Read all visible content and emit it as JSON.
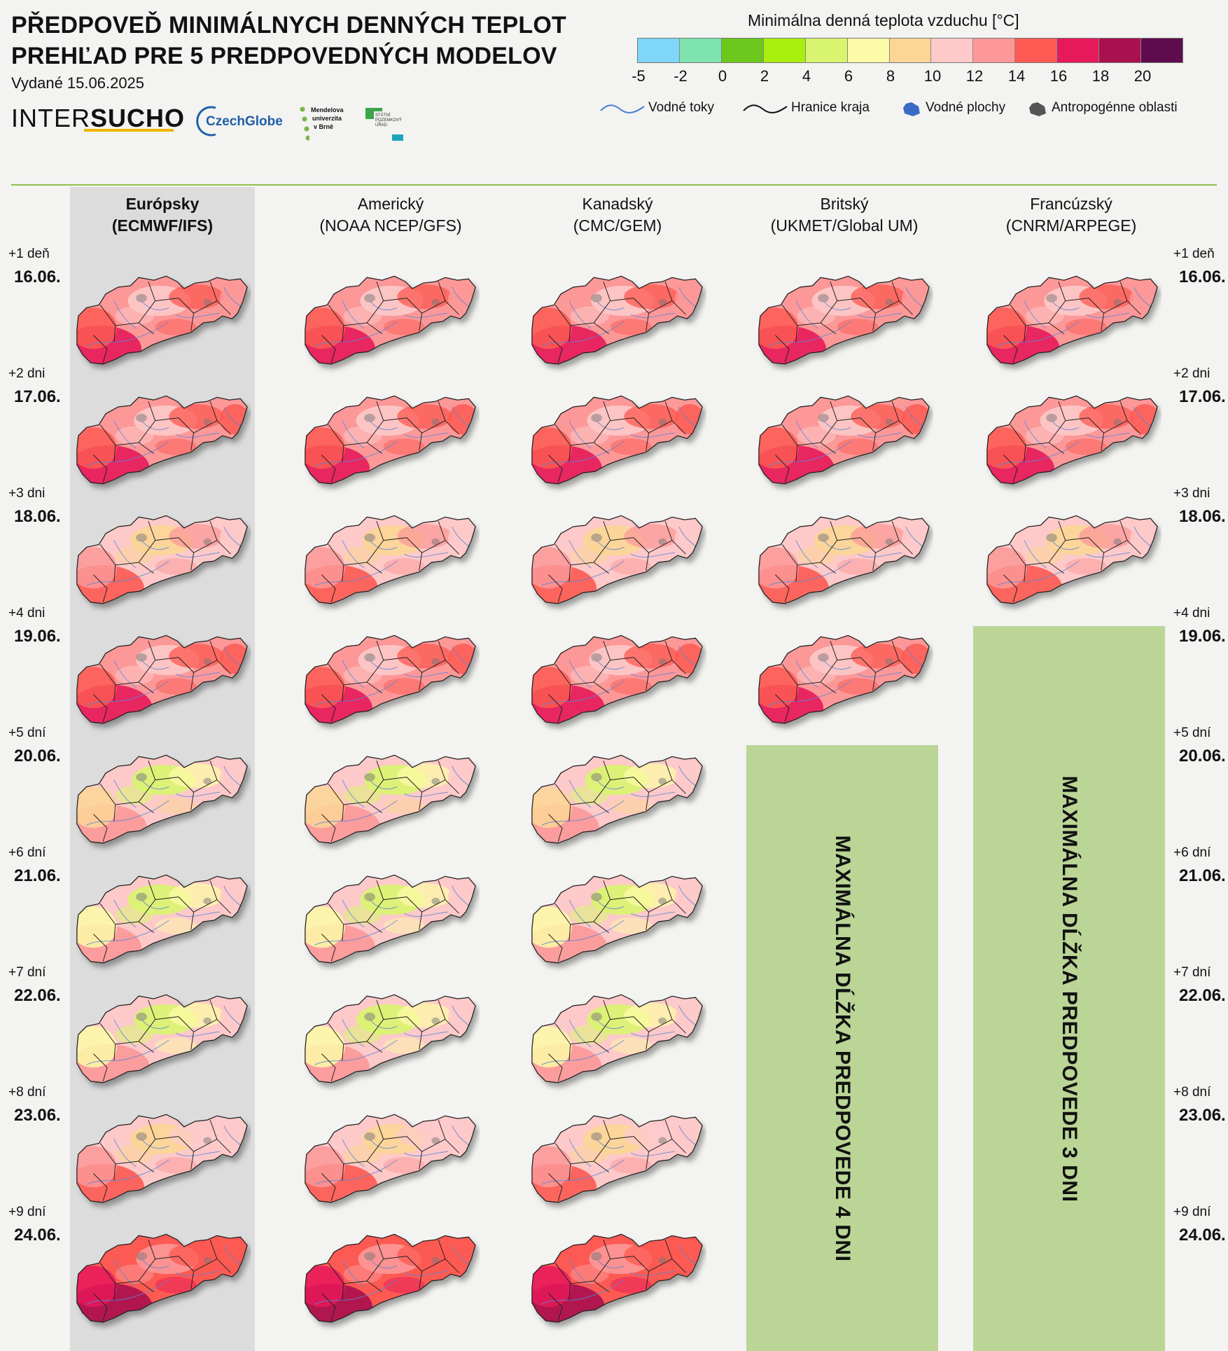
{
  "header": {
    "title_line1": "PŘEDPOVEĎ MINIMÁLNYCH DENNÝCH TEPLOT",
    "title_line2": "PREHĽAD PRE 5 PREDPOVEDNÝCH MODELOV",
    "issued": "Vydané 15.06.2025"
  },
  "logos": {
    "intersucho_a": "INTER",
    "intersucho_b": "SUCHO",
    "czechglobe": "CzechGlobe",
    "mendel": [
      "Mendelova",
      "univerzita",
      "v Brně"
    ],
    "spu": [
      "STÁTNÍ",
      "POZEMKOVÝ",
      "ÚŘAD"
    ]
  },
  "legend": {
    "title": "Minimálna denná teplota vzduchu [°C]",
    "colors": [
      "#7fd6f7",
      "#7ee3ad",
      "#6cc81d",
      "#a9ef0d",
      "#d9f56f",
      "#fcfaa7",
      "#fbd695",
      "#fdc9c9",
      "#fc9898",
      "#fc5a52",
      "#e6195a",
      "#a8104e",
      "#5e0c4d"
    ],
    "ticks": [
      "-5",
      "-2",
      "0",
      "2",
      "4",
      "6",
      "8",
      "10",
      "12",
      "14",
      "16",
      "18",
      "20"
    ],
    "symbols": [
      {
        "icon": "river-line-icon",
        "label": "Vodné toky"
      },
      {
        "icon": "border-line-icon",
        "label": "Hranice kraja"
      },
      {
        "icon": "water-area-icon",
        "label": "Vodné plochy"
      },
      {
        "icon": "urban-area-icon",
        "label": "Antropogénne oblasti"
      }
    ]
  },
  "models": [
    {
      "name": "Európsky",
      "sub": "(ECMWF/IFS)",
      "highlight": true,
      "days": 9
    },
    {
      "name": "Americký",
      "sub": "(NOAA NCEP/GFS)",
      "highlight": false,
      "days": 9
    },
    {
      "name": "Kanadský",
      "sub": "(CMC/GEM)",
      "highlight": false,
      "days": 9
    },
    {
      "name": "Britský",
      "sub": "(UKMET/Global UM)",
      "highlight": false,
      "days": 4
    },
    {
      "name": "Francúzský",
      "sub": "(CNRM/ARPEGE)",
      "highlight": false,
      "days": 3
    }
  ],
  "days": [
    {
      "lead": "+1 deň",
      "date": "16.06."
    },
    {
      "lead": "+2 dni",
      "date": "17.06."
    },
    {
      "lead": "+3 dni",
      "date": "18.06."
    },
    {
      "lead": "+4 dni",
      "date": "19.06."
    },
    {
      "lead": "+5 dní",
      "date": "20.06."
    },
    {
      "lead": "+6 dní",
      "date": "21.06."
    },
    {
      "lead": "+7 dní",
      "date": "22.06."
    },
    {
      "lead": "+8 dní",
      "date": "23.06."
    },
    {
      "lead": "+9 dní",
      "date": "24.06."
    }
  ],
  "map_palettes": [
    [
      "#fc9898",
      "#fc5a52",
      "#e6195a",
      "#fdc9c9",
      "#fc5a52",
      "#fc9898"
    ],
    [
      "#fc9898",
      "#fc5a52",
      "#e6195a",
      "#fdc9c9",
      "#fc5a52",
      "#fc5a52"
    ],
    [
      "#fdc9c9",
      "#fc9898",
      "#fc5a52",
      "#fbd695",
      "#fc9898",
      "#fdc9c9"
    ],
    [
      "#fc9898",
      "#fc5a52",
      "#e6195a",
      "#fdc9c9",
      "#fc5a52",
      "#fc5a52"
    ],
    [
      "#fdc9c9",
      "#fbd695",
      "#fc9898",
      "#d9f56f",
      "#fcfaa7",
      "#fdc9c9"
    ],
    [
      "#fdc9c9",
      "#fcfaa7",
      "#fc9898",
      "#d9f56f",
      "#fcfaa7",
      "#fdc9c9"
    ],
    [
      "#fdc9c9",
      "#fcfaa7",
      "#fc9898",
      "#d9f56f",
      "#fcfaa7",
      "#fdc9c9"
    ],
    [
      "#fdc9c9",
      "#fc9898",
      "#fc5a52",
      "#fbd695",
      "#fdc9c9",
      "#fdc9c9"
    ],
    [
      "#fc5a52",
      "#e6195a",
      "#a8104e",
      "#fc9898",
      "#fc5a52",
      "#fc5a52"
    ]
  ],
  "nodata_texts": [
    "MAXIMÁLNA DĹŽKA PREDPOVEDE 4 DNI",
    "MAXIMÁLNA DĹŽKA PREDPOVEDE 3 DNI"
  ]
}
